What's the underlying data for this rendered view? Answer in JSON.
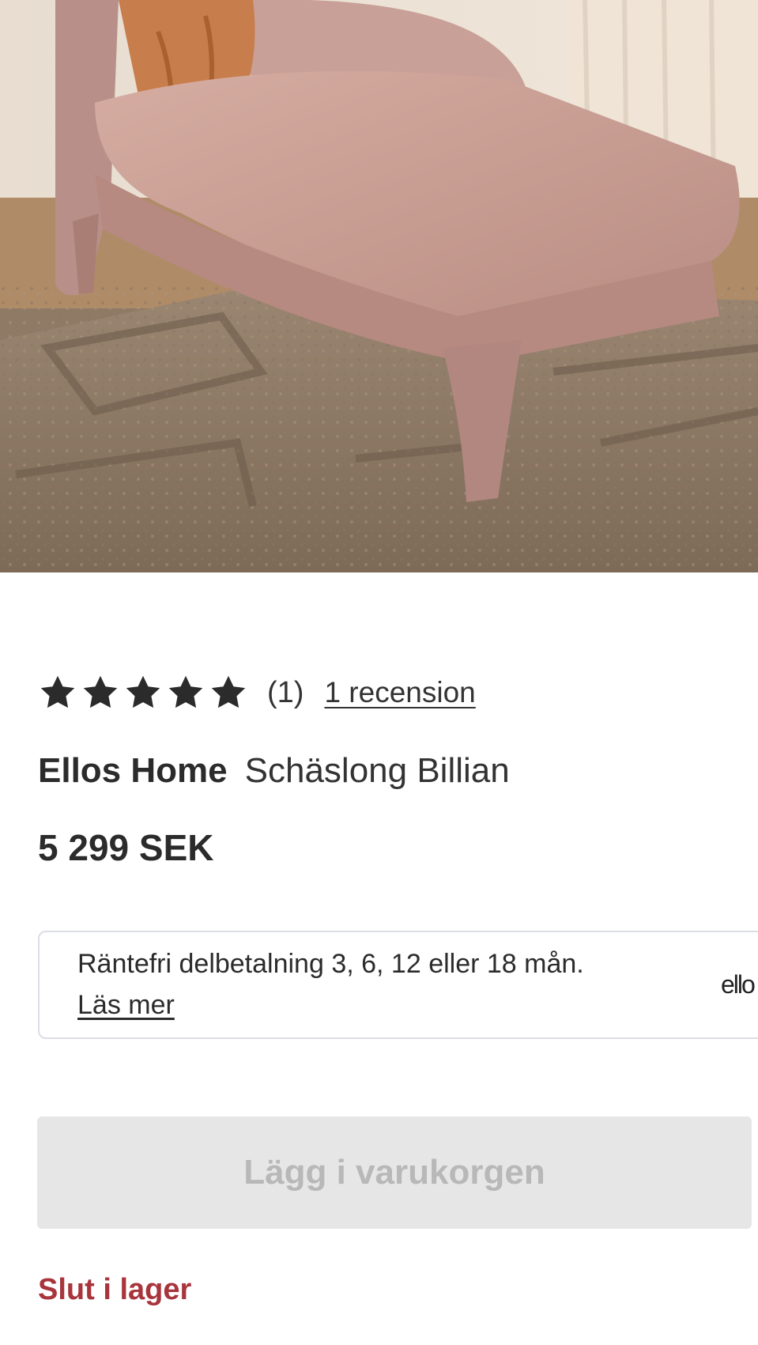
{
  "product": {
    "image_alt": "pink chaise longue on a textured rug",
    "rating": {
      "value": 5,
      "max": 5,
      "icon": "star-icon",
      "count": "(1)",
      "review_link": "1 recension"
    },
    "brand": "Ellos Home",
    "name": "Schäslong Billian",
    "price": "5 299 SEK"
  },
  "financing": {
    "text": "Räntefri delbetalning 3, 6, 12 eller 18 mån.",
    "link": "Läs mer",
    "logo": "ello"
  },
  "cart": {
    "button_label": "Lägg i varukorgen",
    "disabled": true
  },
  "stock_status": "Slut i lager",
  "colors": {
    "star": "#2b2b2b",
    "out_of_stock": "#a8343c",
    "button_disabled_bg": "#e6e6e6",
    "button_disabled_text": "#b8b8b8",
    "finance_border": "#dcdde6"
  }
}
